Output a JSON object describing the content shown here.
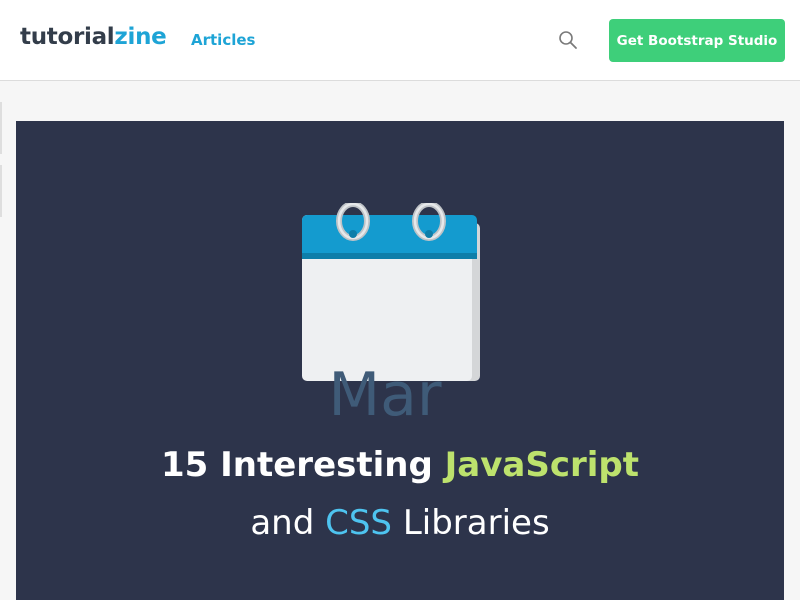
{
  "header": {
    "logo": {
      "part1": "tutorial",
      "part2": "zine"
    },
    "nav": {
      "articles_label": "Articles"
    },
    "search": {
      "icon": "search-icon"
    },
    "cta_label": "Get Bootstrap Studio"
  },
  "hero": {
    "calendar": {
      "icon": "calendar-icon",
      "month": "Mar"
    },
    "title": {
      "line1_prefix": "15 Interesting ",
      "line1_highlight": "JavaScript",
      "line2_prefix": "and ",
      "line2_highlight": "CSS",
      "line2_suffix": " Libraries"
    }
  },
  "colors": {
    "brand_blue": "#1ea4d6",
    "cta_green": "#3ecf7a",
    "hero_bg": "#2d344b",
    "highlight_green": "#bde26d",
    "highlight_blue": "#4ec4f0",
    "logo_dark": "#333d4a"
  }
}
